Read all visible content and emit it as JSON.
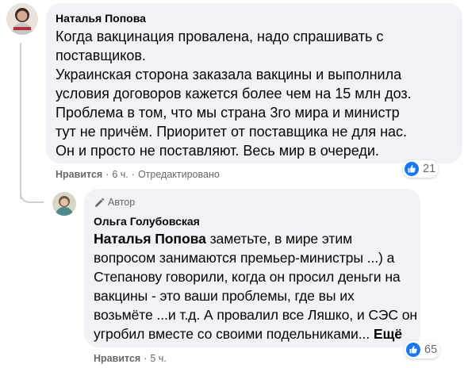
{
  "colors": {
    "bubble": "#f0f2f5",
    "secondary_text": "#65676b",
    "like_blue": "#1877f2"
  },
  "comment1": {
    "author": "Наталья Попова",
    "lines": [
      "Когда вакцинация провалена, надо спрашивать с",
      "поставщиков.",
      "Украинская сторона заказала вакцины и выполнила",
      "условия договоров кажется более чем на 15 млн доз.",
      "Проблема в том, что мы страна 3го мира и министр",
      "тут не причём. Приоритет от поставщика не для нас.",
      "Он и просто не поставляют. Весь мир в очереди."
    ],
    "like_label": "Нравится",
    "time": "6 ч.",
    "edited": "Отредактировано",
    "reactions_count": "21",
    "reaction_icon": "thumbs-up-icon"
  },
  "comment2": {
    "badge": "Автор",
    "badge_icon": "pen-icon",
    "author": "Ольга Голубовская",
    "mention": "Наталья Попова",
    "line1_rest": " заметьте, в мире этим",
    "lines": [
      "вопросом занимаются премьер-министры ...) а",
      "Степанову говорили, когда он просил деньги на",
      "вакцины - это ваши проблемы, где вы их",
      "возьмёте ...и т.д. А провалил все Ляшко, и СЭС он"
    ],
    "last_line": "угробил вместе со своими подельниками...",
    "more_label": "Ещё",
    "like_label": "Нравится",
    "time": "5 ч.",
    "reactions_count": "65",
    "reaction_icon": "thumbs-up-icon"
  }
}
